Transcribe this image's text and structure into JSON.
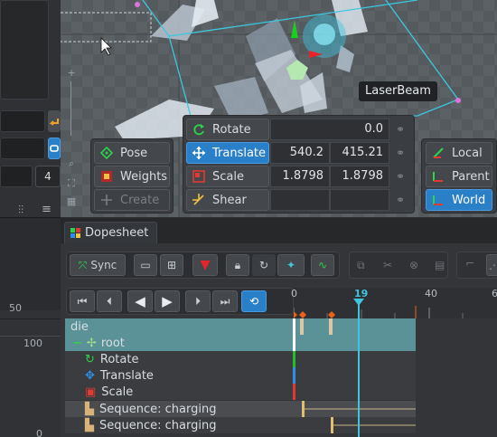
{
  "viewport": {
    "bone_label": "LaserBeam"
  },
  "left_panel": {
    "field_value": "4",
    "ruler_top": "50",
    "ruler_mid": "100",
    "ruler_bottom": "0"
  },
  "tools": {
    "pose": "Pose",
    "weights": "Weights",
    "create": "Create",
    "rotate": {
      "label": "Rotate",
      "value": "0.0"
    },
    "translate": {
      "label": "Translate",
      "x": "540.2",
      "y": "415.21"
    },
    "scale": {
      "label": "Scale",
      "x": "1.8798",
      "y": "1.8798"
    },
    "shear": {
      "label": "Shear"
    },
    "local": "Local",
    "parent": "Parent",
    "world": "World"
  },
  "dopesheet": {
    "tab_title": "Dopesheet",
    "sync": "Sync",
    "timeline": {
      "ticks": [
        "0",
        "19",
        "40",
        "6"
      ],
      "current_frame": "19"
    },
    "rows": [
      {
        "label": "die"
      },
      {
        "label": "root"
      },
      {
        "label": "Rotate"
      },
      {
        "label": "Translate"
      },
      {
        "label": "Scale"
      },
      {
        "label": "Sequence: charging"
      },
      {
        "label": "Sequence: charging"
      }
    ]
  },
  "colors": {
    "accent": "#2a7fc9",
    "anim_row": "#5a9298",
    "playhead": "#3ec6e0",
    "key_orange": "#e8641c",
    "rotate_green": "#22c02b",
    "translate_blue": "#2e8fe8",
    "scale_red": "#e23a30"
  }
}
